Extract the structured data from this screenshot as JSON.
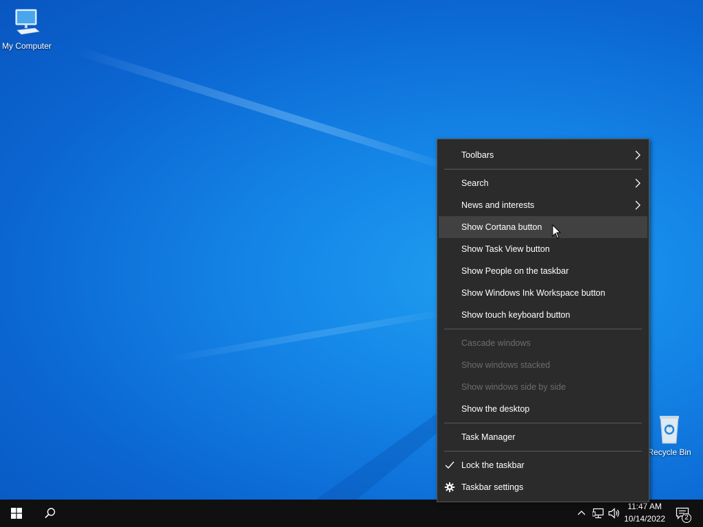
{
  "desktop": {
    "icons": [
      {
        "label": "My Computer",
        "icon": "computer-icon"
      },
      {
        "label": "Recycle Bin",
        "icon": "recycle-bin-icon"
      }
    ]
  },
  "context_menu": {
    "items": [
      {
        "label": "Toolbars",
        "submenu": true
      },
      {
        "label": "Search",
        "submenu": true
      },
      {
        "label": "News and interests",
        "submenu": true
      },
      {
        "label": "Show Cortana button",
        "state": "hover"
      },
      {
        "label": "Show Task View button"
      },
      {
        "label": "Show People on the taskbar"
      },
      {
        "label": "Show Windows Ink Workspace button"
      },
      {
        "label": "Show touch keyboard button"
      },
      {
        "label": "Cascade windows",
        "disabled": true
      },
      {
        "label": "Show windows stacked",
        "disabled": true
      },
      {
        "label": "Show windows side by side",
        "disabled": true
      },
      {
        "label": "Show the desktop"
      },
      {
        "label": "Task Manager"
      },
      {
        "label": "Lock the taskbar",
        "checked": true
      },
      {
        "label": "Taskbar settings",
        "icon": "gear-icon"
      }
    ]
  },
  "taskbar": {
    "clock_time": "11:47 AM",
    "clock_date": "10/14/2022",
    "notification_count": "2"
  },
  "colors": {
    "menu_bg": "#2b2b2b",
    "menu_hover": "#414141",
    "menu_disabled_text": "#6d6d6d",
    "taskbar_bg": "#101010",
    "desktop_blue": "#1484e6"
  }
}
